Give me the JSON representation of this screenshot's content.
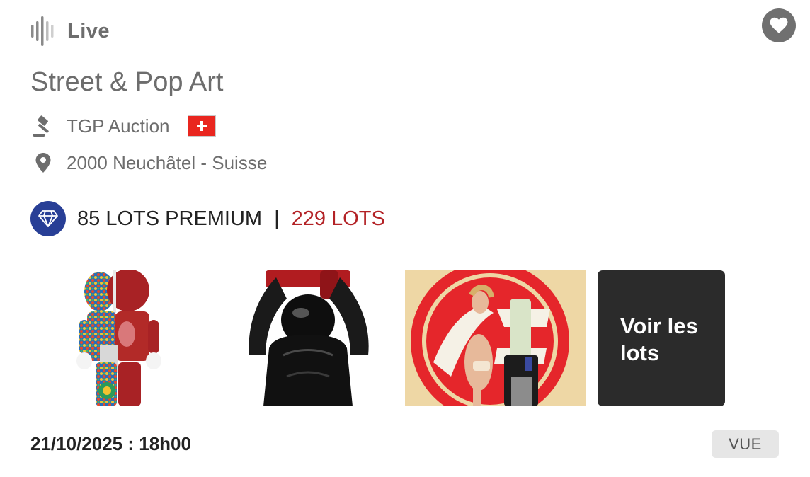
{
  "status": {
    "label": "Live",
    "icon": "sound-wave-icon"
  },
  "favorite": {
    "icon": "heart-icon"
  },
  "auction": {
    "title": "Street & Pop Art",
    "house": "TGP Auction",
    "house_icon": "gavel-icon",
    "country_flag": "swiss-flag-icon",
    "location": "2000 Neuchâtel - Suisse",
    "location_icon": "location-pin-icon"
  },
  "lots": {
    "premium_icon": "diamond-icon",
    "premium": "85 LOTS PREMIUM",
    "separator": "|",
    "total": "229 LOTS"
  },
  "thumbnails": [
    {
      "name": "art-toy-figure-image"
    },
    {
      "name": "black-gorilla-sculpture-image"
    },
    {
      "name": "pinup-poster-image"
    }
  ],
  "view_lots": {
    "label": "Voir les lots"
  },
  "date": "21/10/2025 : 18h00",
  "badge": "VUE",
  "colors": {
    "accent_red": "#b32226",
    "diamond_blue": "#283f96",
    "dark_button": "#2b2b2b"
  }
}
